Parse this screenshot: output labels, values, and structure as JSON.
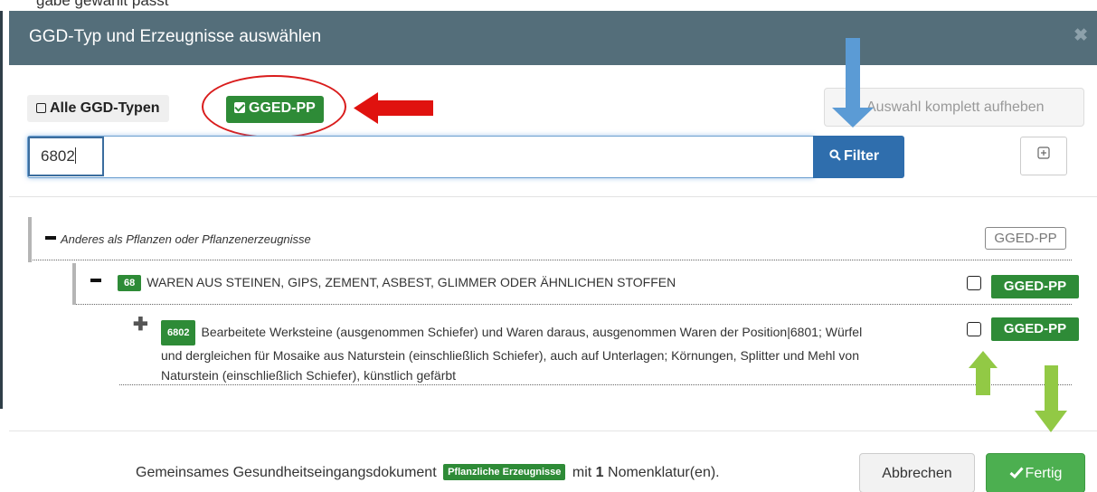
{
  "top_strip_text": "gabe gewählt passt",
  "modal": {
    "title": "GGD-Typ und Erzeugnisse auswählen",
    "close_icon": "close-icon"
  },
  "type_selector": {
    "all_label": "Alle GGD-Typen",
    "all_checked": false,
    "gged_label": "GGED-PP",
    "gged_checked": true
  },
  "reset_button": "Auswahl komplett aufheben",
  "search": {
    "value": "6802",
    "filter_label": "Filter",
    "filter_icon": "search-icon",
    "expand_icon": "expand-all-icon"
  },
  "tree": {
    "root": {
      "label": "Anderes als Pflanzen oder Pflanzenerzeugnisse",
      "tag": "GGED-PP",
      "toggle": "collapse-icon"
    },
    "level1": {
      "code": "68",
      "label": "WAREN AUS STEINEN, GIPS, ZEMENT, ASBEST, GLIMMER ODER ÄHNLICHEN STOFFEN",
      "tag": "GGED-PP",
      "checked": false,
      "toggle": "collapse-icon"
    },
    "level2": {
      "code": "6802",
      "line1": "Bearbeitete Werksteine (ausgenommen Schiefer) und Waren daraus, ausgenommen Waren der Position|6801; Würfel",
      "line2": "und dergleichen für Mosaike aus Naturstein (einschließlich Schiefer), auch auf Unterlagen; Körnungen, Splitter und Mehl von",
      "line3": "Naturstein (einschließlich Schiefer), künstlich gefärbt",
      "tag": "GGED-PP",
      "checked": false,
      "toggle": "expand-icon"
    }
  },
  "footer": {
    "text_before": "Gemeinsames Gesundheitseingangsdokument",
    "badge": "Pflanzliche Erzeugnisse",
    "text_mid": "mit",
    "count": "1",
    "text_after": "Nomenklatur(en).",
    "cancel_label": "Abbrechen",
    "done_label": "Fertig",
    "done_icon": "checkmark-icon"
  },
  "annotation_colors": {
    "red": "#e0120f",
    "blue": "#5b9bd5",
    "green": "#92c945"
  }
}
